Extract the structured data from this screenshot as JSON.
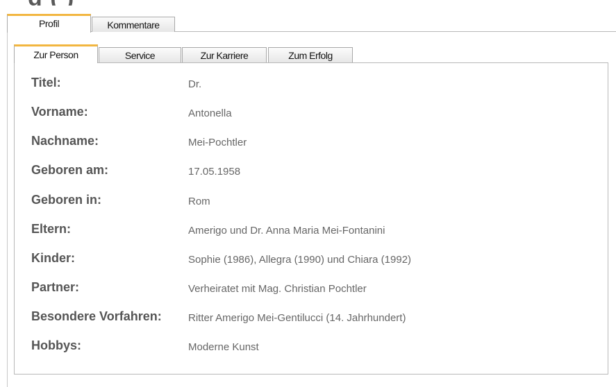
{
  "header": {
    "clipped_title": "  g                            (                              )"
  },
  "outer_tabs": [
    {
      "label": "Profil",
      "active": true
    },
    {
      "label": "Kommentare",
      "active": false
    }
  ],
  "inner_tabs": [
    {
      "label": "Zur Person",
      "active": true
    },
    {
      "label": "Service",
      "active": false
    },
    {
      "label": "Zur Karriere",
      "active": false
    },
    {
      "label": "Zum Erfolg",
      "active": false
    }
  ],
  "person": {
    "rows": [
      {
        "label": "Titel:",
        "value": "Dr."
      },
      {
        "label": "Vorname:",
        "value": "Antonella"
      },
      {
        "label": "Nachname:",
        "value": "Mei-Pochtler"
      },
      {
        "label": "Geboren am:",
        "value": "17.05.1958"
      },
      {
        "label": "Geboren in:",
        "value": "Rom"
      },
      {
        "label": "Eltern:",
        "value": "Amerigo und Dr. Anna Maria Mei-Fontanini"
      },
      {
        "label": "Kinder:",
        "value": "Sophie (1986), Allegra (1990) und Chiara (1992)"
      },
      {
        "label": "Partner:",
        "value": "Verheiratet mit Mag. Christian Pochtler"
      },
      {
        "label": "Besondere Vorfahren:",
        "value": "Ritter Amerigo Mei-Gentilucci (14. Jahrhundert)"
      },
      {
        "label": "Hobbys:",
        "value": "Moderne Kunst"
      }
    ]
  },
  "colors": {
    "active_tab_accent": "#f2b640",
    "label_text": "#555555",
    "value_text": "#666666",
    "border": "#b8b8b8"
  }
}
